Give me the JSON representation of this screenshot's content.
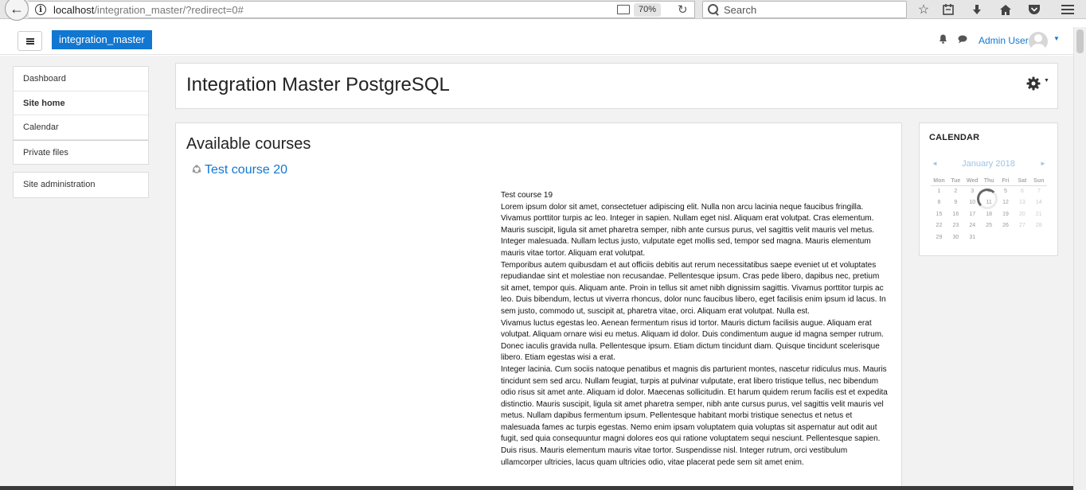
{
  "browser": {
    "url_host": "localhost",
    "url_path": "/integration_master/?redirect=0#",
    "zoom": "70%",
    "search_placeholder": "Search"
  },
  "navbar": {
    "brand": "integration_master",
    "user_name": "Admin User"
  },
  "nav": {
    "items": [
      {
        "label": "Dashboard"
      },
      {
        "label": "Site home"
      },
      {
        "label": "Calendar"
      },
      {
        "label": "Private files"
      }
    ],
    "admin_label": "Site administration"
  },
  "header": {
    "title": "Integration Master PostgreSQL"
  },
  "main": {
    "heading": "Available courses",
    "course_link": "Test course 20",
    "summary_title": "Test course 19",
    "summary_paragraphs": [
      "Lorem ipsum dolor sit amet, consectetuer adipiscing elit. Nulla non arcu lacinia neque faucibus fringilla. Vivamus porttitor turpis ac leo. Integer in sapien. Nullam eget nisl. Aliquam erat volutpat. Cras elementum. Mauris suscipit, ligula sit amet pharetra semper, nibh ante cursus purus, vel sagittis velit mauris vel metus. Integer malesuada. Nullam lectus justo, vulputate eget mollis sed, tempor sed magna. Mauris elementum mauris vitae tortor. Aliquam erat volutpat.",
      "Temporibus autem quibusdam et aut officiis debitis aut rerum necessitatibus saepe eveniet ut et voluptates repudiandae sint et molestiae non recusandae. Pellentesque ipsum. Cras pede libero, dapibus nec, pretium sit amet, tempor quis. Aliquam ante. Proin in tellus sit amet nibh dignissim sagittis. Vivamus porttitor turpis ac leo. Duis bibendum, lectus ut viverra rhoncus, dolor nunc faucibus libero, eget facilisis enim ipsum id lacus. In sem justo, commodo ut, suscipit at, pharetra vitae, orci. Aliquam erat volutpat. Nulla est.",
      "Vivamus luctus egestas leo. Aenean fermentum risus id tortor. Mauris dictum facilisis augue. Aliquam erat volutpat. Aliquam ornare wisi eu metus. Aliquam id dolor. Duis condimentum augue id magna semper rutrum. Donec iaculis gravida nulla. Pellentesque ipsum. Etiam dictum tincidunt diam. Quisque tincidunt scelerisque libero. Etiam egestas wisi a erat.",
      "Integer lacinia. Cum sociis natoque penatibus et magnis dis parturient montes, nascetur ridiculus mus. Mauris tincidunt sem sed arcu. Nullam feugiat, turpis at pulvinar vulputate, erat libero tristique tellus, nec bibendum odio risus sit amet ante. Aliquam id dolor. Maecenas sollicitudin. Et harum quidem rerum facilis est et expedita distinctio. Mauris suscipit, ligula sit amet pharetra semper, nibh ante cursus purus, vel sagittis velit mauris vel metus. Nullam dapibus fermentum ipsum. Pellentesque habitant morbi tristique senectus et netus et malesuada fames ac turpis egestas. Nemo enim ipsam voluptatem quia voluptas sit aspernatur aut odit aut fugit, sed quia consequuntur magni dolores eos qui ratione voluptatem sequi nesciunt. Pellentesque sapien. Duis risus. Mauris elementum mauris vitae tortor. Suspendisse nisl. Integer rutrum, orci vestibulum ullamcorper ultricies, lacus quam ultricies odio, vitae placerat pede sem sit amet enim."
    ]
  },
  "calendar": {
    "title": "CALENDAR",
    "prev": "◄",
    "next": "►",
    "month": "January 2018",
    "weekdays": [
      "Mon",
      "Tue",
      "Wed",
      "Thu",
      "Fri",
      "Sat",
      "Sun"
    ],
    "weeks": [
      [
        "1",
        "2",
        "3",
        "4",
        "5",
        "6",
        "7"
      ],
      [
        "8",
        "9",
        "10",
        "11",
        "12",
        "13",
        "14"
      ],
      [
        "15",
        "16",
        "17",
        "18",
        "19",
        "20",
        "21"
      ],
      [
        "22",
        "23",
        "24",
        "25",
        "26",
        "27",
        "28"
      ],
      [
        "29",
        "30",
        "31",
        "",
        "",
        "",
        ""
      ]
    ]
  },
  "colors": {
    "brand": "#1177d1",
    "page_bg": "#f2f2f2"
  }
}
